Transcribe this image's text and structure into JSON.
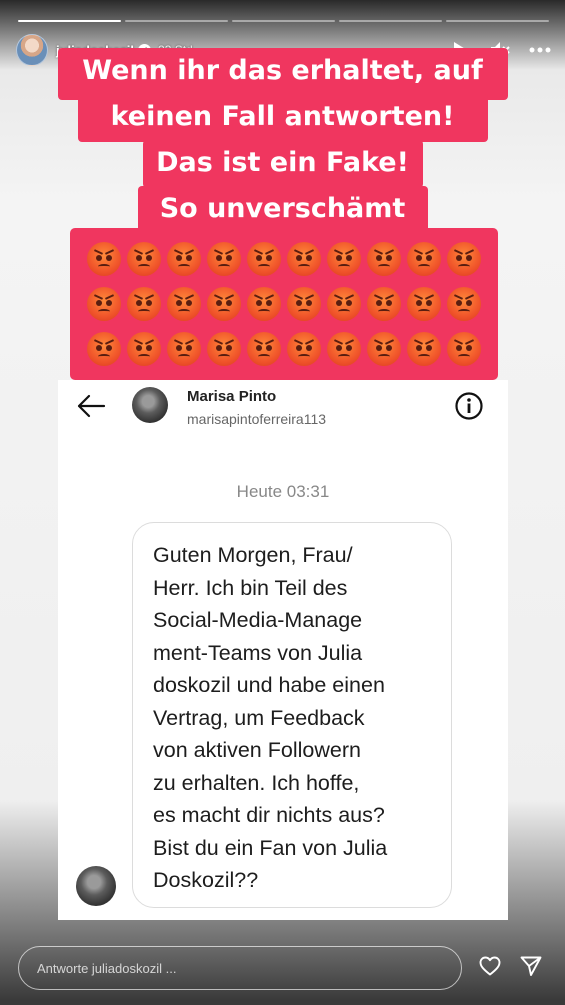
{
  "story": {
    "progress": [
      1,
      0,
      0,
      0,
      0
    ],
    "username": "juliadoskozil",
    "time": "23 Std.",
    "reply_placeholder": "Antworte juliadoskozil ..."
  },
  "sticker": {
    "lines": [
      "Wenn ihr das erhaltet, auf",
      "keinen Fall antworten!",
      "Das ist ein Fake!",
      "So unverschämt"
    ],
    "emoji_count": 30,
    "emoji_name": "angry-face"
  },
  "dm": {
    "name": "Marisa Pinto",
    "handle": "marisapintoferreira113",
    "time": "Heute 03:31",
    "message_lines": [
      "Guten Morgen, Frau/",
      "Herr. Ich bin Teil des",
      "Social-Media-Manage",
      "ment-Teams von Julia",
      "doskozil und habe einen",
      "Vertrag, um Feedback",
      "von aktiven Followern",
      "zu erhalten. Ich hoffe,",
      "es macht dir nichts aus?",
      "Bist du ein Fan von Julia",
      "Doskozil??"
    ]
  },
  "colors": {
    "sticker_red": "#f0365f",
    "emoji_orange": "#f0542a"
  }
}
